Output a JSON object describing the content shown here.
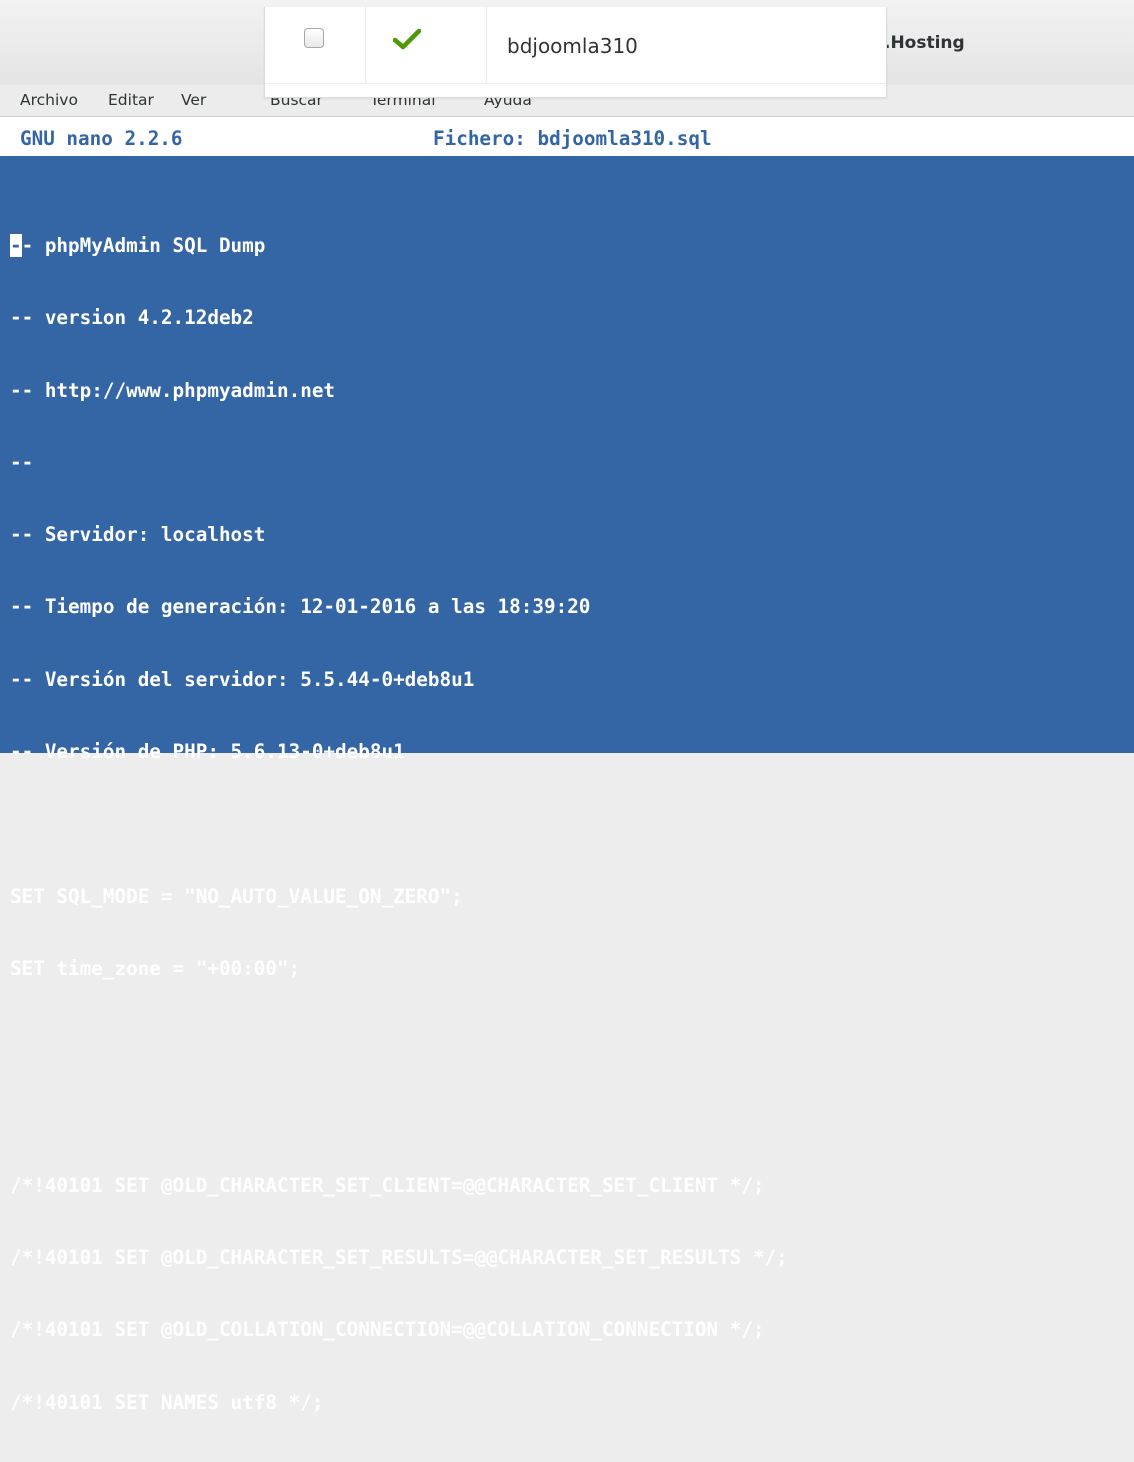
{
  "window": {
    "title_visible": ".Hosting"
  },
  "menubar": {
    "items": [
      "Archivo",
      "Editar",
      "Ver",
      "Buscar",
      "Terminal",
      "Ayuda"
    ]
  },
  "overlay_row": {
    "database_name": "bdjoomla310",
    "checked": false,
    "status": "ok"
  },
  "nano": {
    "version_label": "GNU nano 2.2.6",
    "file_label": "Fichero: bdjoomla310.sql"
  },
  "editor": {
    "cursor_char": "-",
    "lines": [
      "- phpMyAdmin SQL Dump",
      "-- version 4.2.12deb2",
      "-- http://www.phpmyadmin.net",
      "--",
      "-- Servidor: localhost",
      "-- Tiempo de generación: 12-01-2016 a las 18:39:20",
      "-- Versión del servidor: 5.5.44-0+deb8u1",
      "-- Versión de PHP: 5.6.13-0+deb8u1",
      "",
      "SET SQL_MODE = \"NO_AUTO_VALUE_ON_ZERO\";",
      "SET time_zone = \"+00:00\";",
      "",
      "",
      "/*!40101 SET @OLD_CHARACTER_SET_CLIENT=@@CHARACTER_SET_CLIENT */;",
      "/*!40101 SET @OLD_CHARACTER_SET_RESULTS=@@CHARACTER_SET_RESULTS */;",
      "/*!40101 SET @OLD_COLLATION_CONNECTION=@@COLLATION_CONNECTION */;",
      "/*!40101 SET NAMES utf8 */;"
    ]
  },
  "colors": {
    "terminal_bg": "#3465a4",
    "terminal_fg": "#ffffff",
    "check_green": "#4e9a06"
  }
}
